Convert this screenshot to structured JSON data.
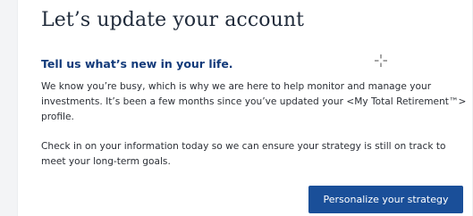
{
  "card": {
    "title": "Let’s update your account",
    "subtitle": "Tell us what’s new in your life.",
    "paragraph_1": "We know you’re busy, which is why we are here to help monitor and manage your investments. It’s been a few months since you’ve updated your <My Total Retirement™> profile.",
    "paragraph_2": "Check in on your information today so we can ensure your strategy is still on track to meet your long-term goals.",
    "cta_label": "Personalize your strategy"
  },
  "icons": {
    "cursor": "crosshair-cursor-icon"
  },
  "colors": {
    "title": "#1f2a3a",
    "subtitle": "#123a7a",
    "body_text": "#2b2f36",
    "button_bg": "#1a4f99",
    "button_text": "#ffffff",
    "page_bg": "#f3f4f6",
    "card_bg": "#ffffff"
  }
}
